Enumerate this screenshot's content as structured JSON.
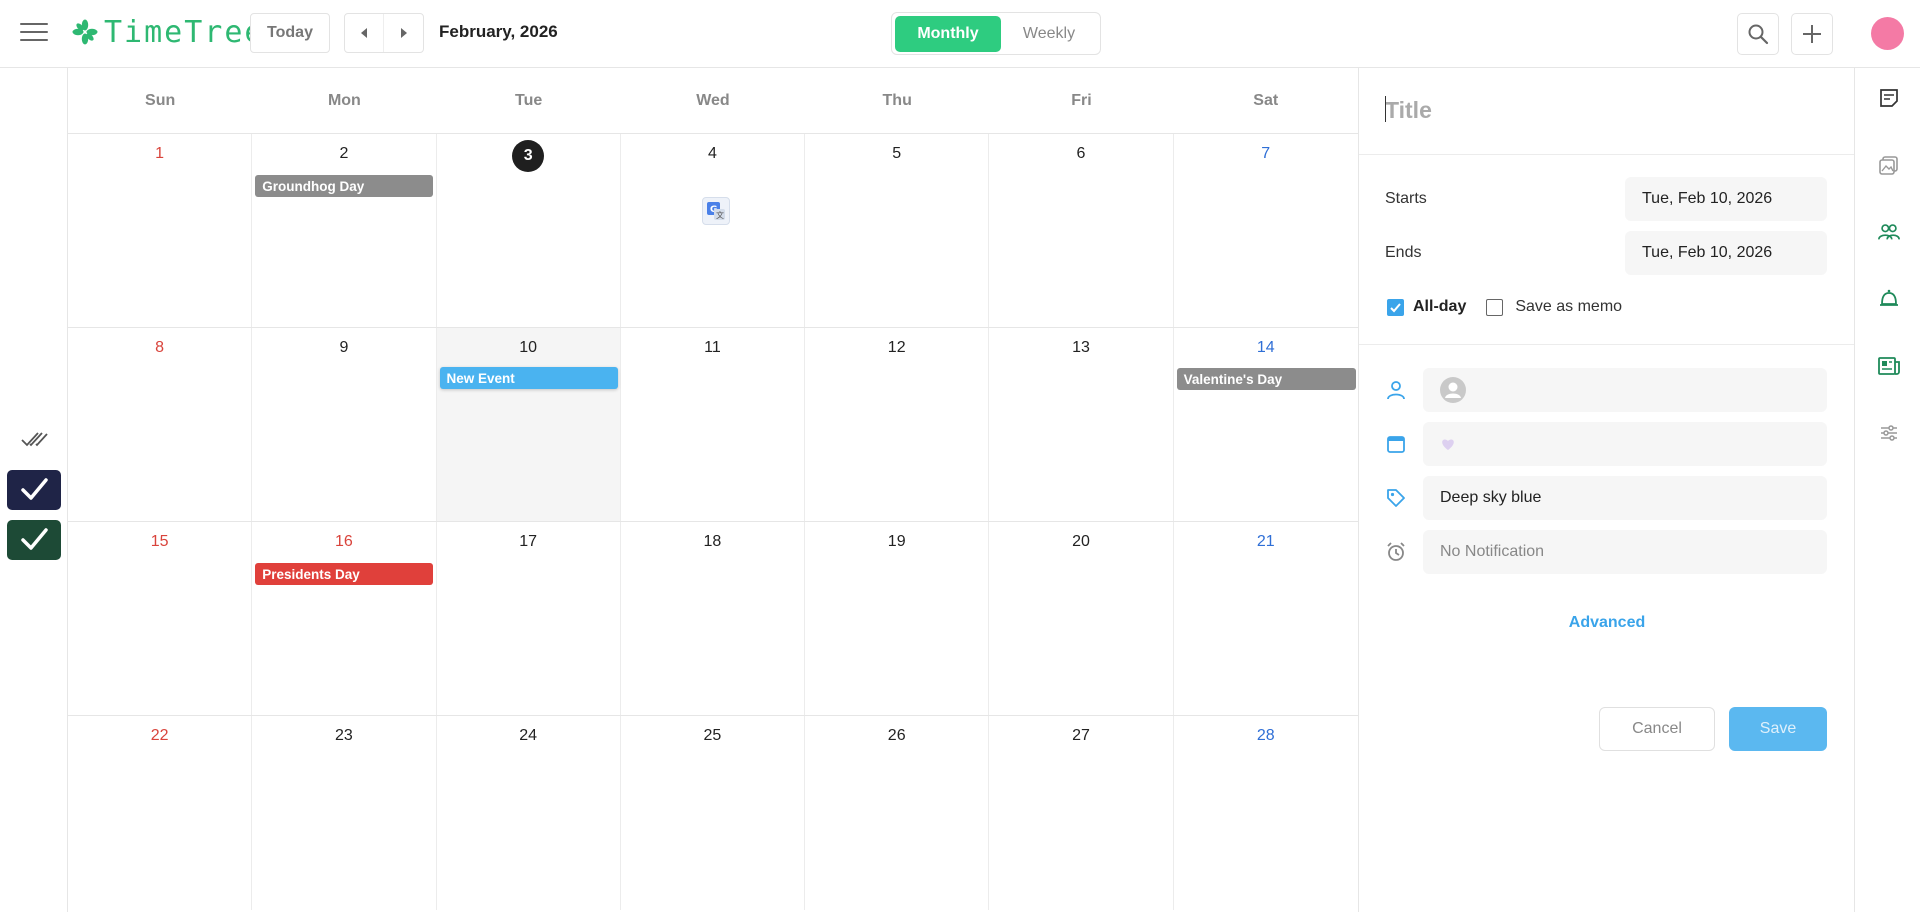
{
  "header": {
    "app_name": "TimeTree",
    "today_label": "Today",
    "month_label": "February, 2026",
    "views": [
      {
        "label": "Monthly",
        "active": true
      },
      {
        "label": "Weekly",
        "active": false
      }
    ],
    "icons": [
      "menu-icon",
      "prev-month-icon",
      "next-month-icon",
      "search-icon",
      "add-icon",
      "profile-avatar"
    ],
    "accent_color": "#2ecc80",
    "avatar_color": "#f47aa5"
  },
  "calendar": {
    "weekdays": [
      "Sun",
      "Mon",
      "Tue",
      "Wed",
      "Thu",
      "Fri",
      "Sat"
    ],
    "weeks": [
      [
        "1",
        "2",
        "3",
        "4",
        "5",
        "6",
        "7"
      ],
      [
        "8",
        "9",
        "10",
        "11",
        "12",
        "13",
        "14"
      ],
      [
        "15",
        "16",
        "17",
        "18",
        "19",
        "20",
        "21"
      ],
      [
        "22",
        "23",
        "24",
        "25",
        "26",
        "27",
        "28"
      ]
    ],
    "today": "3",
    "selected": "10",
    "events": [
      {
        "label": "Groundhog Day",
        "day": "2",
        "color": "#8c8c8c"
      },
      {
        "label": "New Event",
        "day": "10",
        "color": "#4ab3f0"
      },
      {
        "label": "Valentine's Day",
        "day": "14",
        "color": "#8c8c8c"
      },
      {
        "label": "Presidents Day",
        "day": "16",
        "color": "#e0403b"
      }
    ]
  },
  "panel": {
    "title_placeholder": "Title",
    "starts_label": "Starts",
    "starts_value": "Tue, Feb 10, 2026",
    "ends_label": "Ends",
    "ends_value": "Tue, Feb 10, 2026",
    "allday_label": "All-day",
    "allday_checked": true,
    "memo_label": "Save as memo",
    "memo_checked": false,
    "label_value": "Deep sky blue",
    "notification_value": "No Notification",
    "advanced_label": "Advanced",
    "cancel_label": "Cancel",
    "save_label": "Save"
  }
}
